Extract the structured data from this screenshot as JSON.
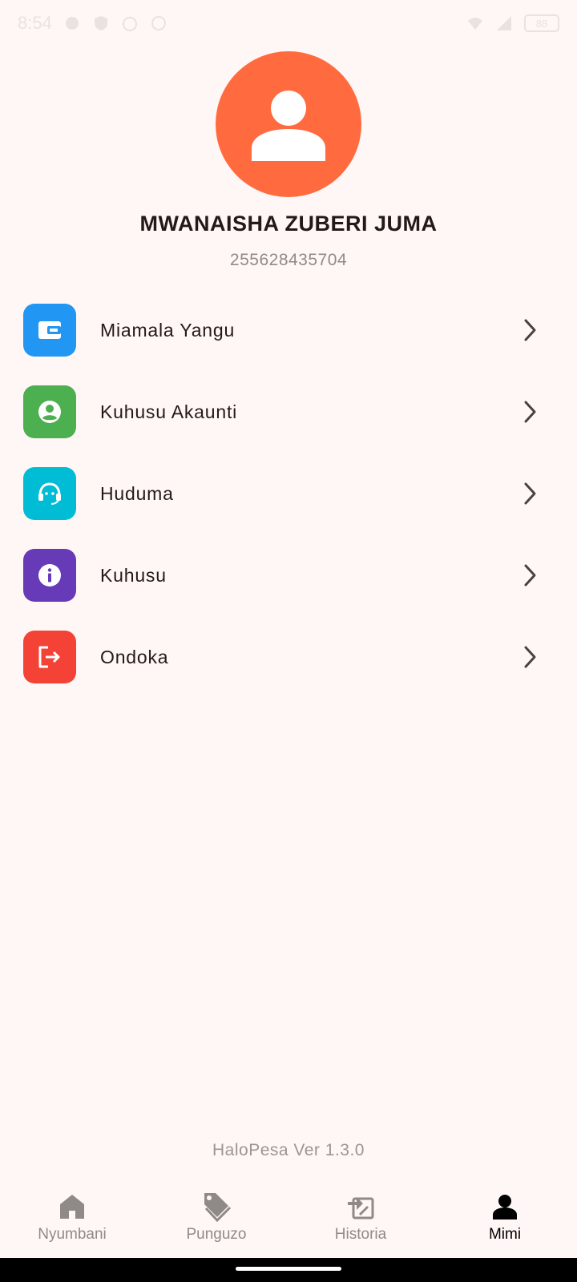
{
  "status_bar": {
    "time": "8:54",
    "battery": "88"
  },
  "profile": {
    "name": "MWANAISHA ZUBERI JUMA",
    "phone": "255628435704"
  },
  "menu": {
    "items": [
      {
        "label": "Miamala Yangu",
        "icon": "wallet-icon",
        "color": "#2196F3"
      },
      {
        "label": "Kuhusu Akaunti",
        "icon": "account-circle-icon",
        "color": "#4CAF50"
      },
      {
        "label": "Huduma",
        "icon": "headset-support-icon",
        "color": "#00BCD4"
      },
      {
        "label": "Kuhusu",
        "icon": "info-icon",
        "color": "#673AB7"
      },
      {
        "label": "Ondoka",
        "icon": "logout-icon",
        "color": "#F44336"
      }
    ]
  },
  "footer": {
    "version": "HaloPesa Ver 1.3.0"
  },
  "bottom_nav": {
    "items": [
      {
        "label": "Nyumbani",
        "icon": "home-icon",
        "active": false
      },
      {
        "label": "Punguzo",
        "icon": "tag-icon",
        "active": false
      },
      {
        "label": "Historia",
        "icon": "history-icon",
        "active": false
      },
      {
        "label": "Mimi",
        "icon": "person-icon",
        "active": true
      }
    ]
  },
  "colors": {
    "background": "#FFF7F5",
    "avatar": "#FF6B3F",
    "text_primary": "#231a18",
    "text_secondary": "#8f8a88"
  }
}
